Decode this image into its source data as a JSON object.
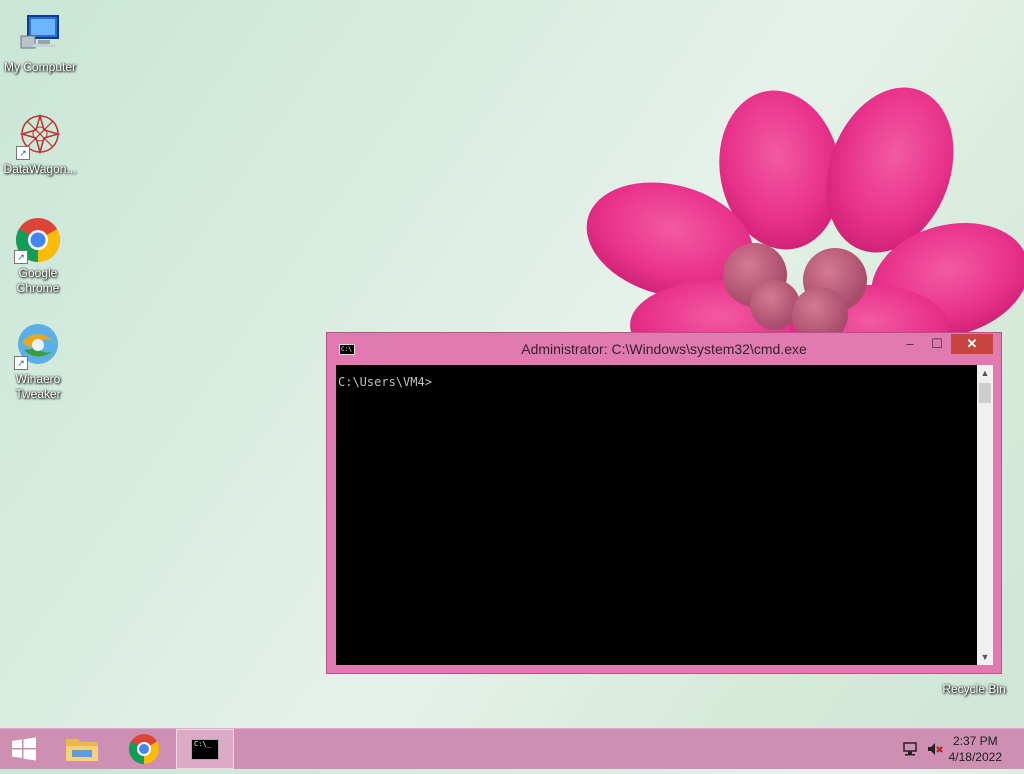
{
  "desktop": {
    "icons": [
      {
        "label": "My Computer"
      },
      {
        "label": "DataWagon..."
      },
      {
        "label_line1": "Google",
        "label_line2": "Chrome"
      },
      {
        "label_line1": "Winaero",
        "label_line2": "Tweaker"
      },
      {
        "label": "Recycle Bin"
      }
    ]
  },
  "cmd_window": {
    "title": "Administrator: C:\\Windows\\system32\\cmd.exe",
    "icon_text": "C:\\",
    "prompt": "C:\\Users\\VM4>",
    "controls": {
      "minimize": "–",
      "maximize": "☐",
      "close": "✕"
    }
  },
  "taskbar": {
    "items": [
      "start-button",
      "file-explorer",
      "google-chrome",
      "command-prompt"
    ],
    "cmd_icon_text": "C:\\_",
    "clock": {
      "time": "2:37 PM",
      "date": "4/18/2022"
    },
    "tray_icons": [
      "network-icon",
      "volume-muted-icon"
    ]
  },
  "colors": {
    "window_frame": "#e07ab0",
    "close_button": "#c8453f",
    "taskbar": "#cf8fb3"
  }
}
